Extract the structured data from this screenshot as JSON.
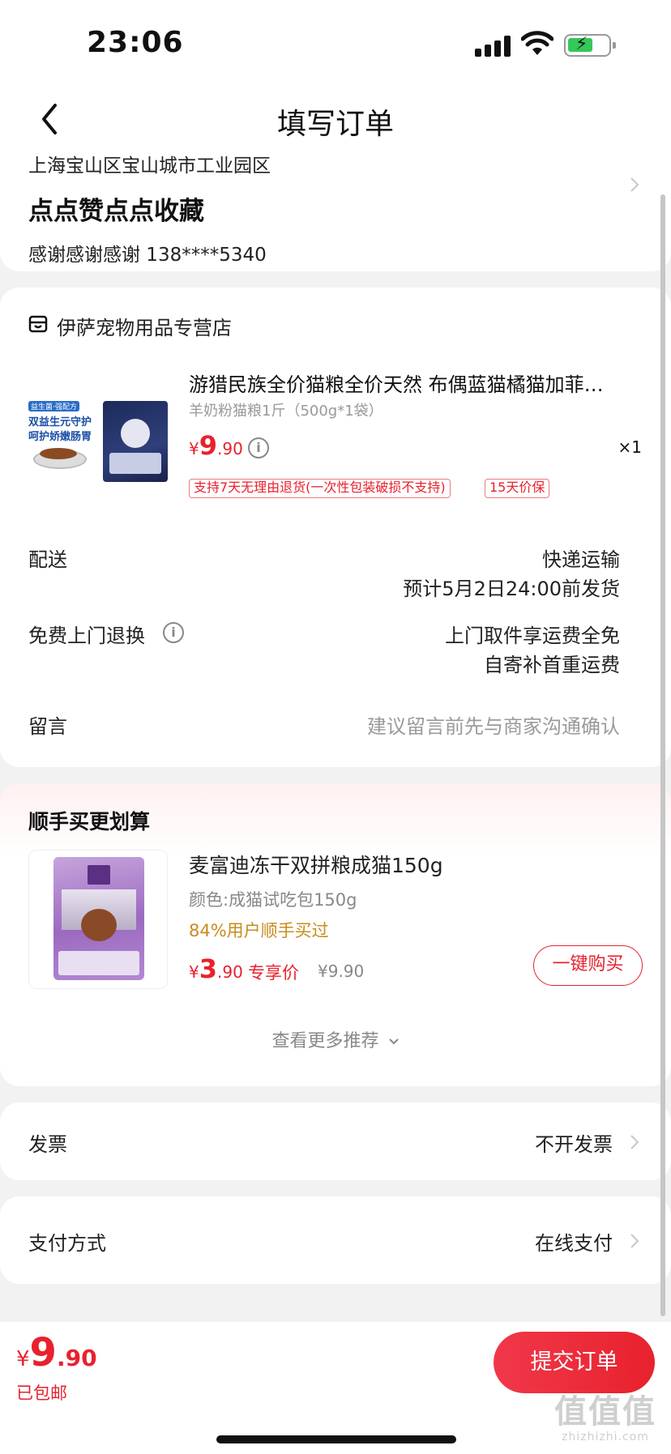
{
  "status_bar": {
    "time": "23:06"
  },
  "header": {
    "title": "填写订单"
  },
  "address": {
    "region": "上海宝山区宝山城市工业园区",
    "detail": "点点赞点点收藏",
    "contact": "感谢感谢感谢  138****5340"
  },
  "store": {
    "name": "伊萨宠物用品专营店",
    "product": {
      "title": "游猎民族全价猫粮全价天然 布偶蓝猫橘猫加菲…",
      "spec": "羊奶粉猫粮1斤（500g*1袋）",
      "price_yen": "¥",
      "price_int": "9",
      "price_dec": ".90",
      "quantity": "×1",
      "image_text": {
        "line1": "双益生元守护",
        "line2": "呵护娇嫩肠胃",
        "badge": "益生菌·强配方"
      },
      "tags": [
        "支持7天无理由退货(一次性包装破损不支持)",
        "15天价保"
      ]
    },
    "delivery": {
      "label": "配送",
      "method": "快递运输",
      "eta": "预计5月2日24:00前发货"
    },
    "return": {
      "label": "免费上门退换",
      "line1": "上门取件享运费全免",
      "line2": "自寄补首重运费"
    },
    "message": {
      "label": "留言",
      "placeholder": "建议留言前先与商家沟通确认"
    }
  },
  "recommend": {
    "title": "顺手买更划算",
    "item": {
      "name": "麦富迪冻干双拼粮成猫150g",
      "spec": "颜色:成猫试吃包150g",
      "social": "84%用户顺手买过",
      "price_yen": "¥",
      "price_int": "3",
      "price_dec": ".90",
      "exclusive": "专享价",
      "original": "¥9.90",
      "buy_button": "一键购买"
    },
    "more": "查看更多推荐"
  },
  "invoice": {
    "label": "发票",
    "value": "不开发票"
  },
  "payment": {
    "label": "支付方式",
    "value": "在线支付"
  },
  "footer": {
    "total_yen": "¥",
    "total_int": "9",
    "total_dec": ".90",
    "shipping": "已包邮",
    "submit": "提交订单"
  },
  "watermark": {
    "line1": "值值值",
    "line2": "zhizhizhi.com"
  },
  "colors": {
    "accent": "#e8212d",
    "social": "#c98b1c",
    "muted": "#9a9a9a"
  }
}
